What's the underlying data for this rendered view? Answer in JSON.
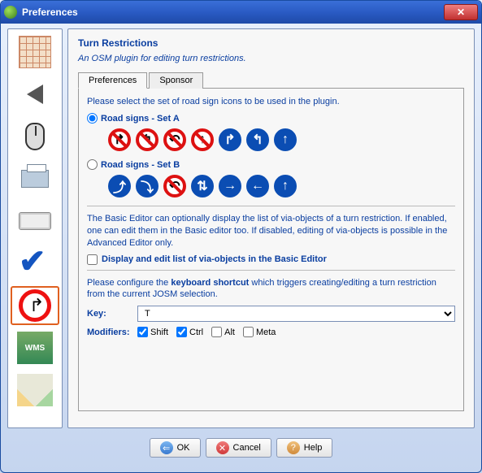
{
  "window": {
    "title": "Preferences"
  },
  "sidebar": {
    "items": [
      {
        "name": "display-grid",
        "label": ""
      },
      {
        "name": "audio",
        "label": ""
      },
      {
        "name": "connection",
        "label": ""
      },
      {
        "name": "printer",
        "label": ""
      },
      {
        "name": "keyboard",
        "label": ""
      },
      {
        "name": "validator",
        "label": ""
      },
      {
        "name": "turn-restrictions",
        "label": ""
      },
      {
        "name": "wms",
        "label": "WMS"
      },
      {
        "name": "map-style",
        "label": ""
      }
    ],
    "selected": "turn-restrictions"
  },
  "panel": {
    "title": "Turn Restrictions",
    "subtitle": "An OSM plugin for editing turn restrictions."
  },
  "tabs": {
    "items": [
      {
        "key": "preferences",
        "label": "Preferences"
      },
      {
        "key": "sponsor",
        "label": "Sponsor"
      }
    ],
    "active": "preferences"
  },
  "iconset": {
    "prompt": "Please select the set of road sign icons to be used in the plugin.",
    "option_a": {
      "label": "Road signs - Set A",
      "selected": true
    },
    "option_b": {
      "label": "Road signs - Set B",
      "selected": false
    },
    "set_a_icons": [
      "no-right-turn",
      "no-left-turn",
      "no-u-turn",
      "no-straight",
      "right-only",
      "left-only",
      "straight-only"
    ],
    "set_b_icons": [
      "right-or-straight",
      "left-or-straight",
      "no-u-turn",
      "both-turns",
      "right-arrow",
      "left-arrow",
      "straight-arrow"
    ]
  },
  "basic_editor": {
    "description": "The Basic Editor can optionally display the list of via-objects of a turn restriction. If enabled, one can edit them in the Basic editor too. If disabled, editing of via-objects is possible in the Advanced Editor only.",
    "checkbox_label": "Display and edit list of via-objects in the Basic Editor",
    "checked": false
  },
  "shortcut": {
    "description_pre": "Please configure the ",
    "description_bold": "keyboard shortcut",
    "description_post": " which triggers creating/editing a turn restriction from the current JOSM selection.",
    "key_label": "Key:",
    "key_value": "T",
    "modifiers_label": "Modifiers:",
    "modifiers": {
      "shift": {
        "label": "Shift",
        "checked": true
      },
      "ctrl": {
        "label": "Ctrl",
        "checked": true
      },
      "alt": {
        "label": "Alt",
        "checked": false
      },
      "meta": {
        "label": "Meta",
        "checked": false
      }
    }
  },
  "footer": {
    "ok": "OK",
    "cancel": "Cancel",
    "help": "Help"
  }
}
